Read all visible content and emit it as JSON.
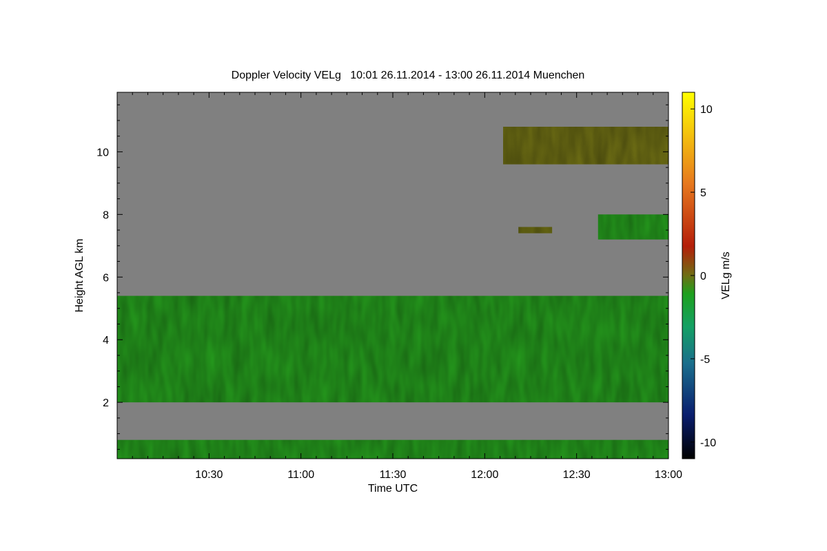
{
  "chart_data": {
    "type": "heatmap",
    "title": "Doppler Velocity VELg   10:01 26.11.2014 - 13:00 26.11.2014 Muenchen",
    "xlabel": "Time UTC",
    "ylabel": "Height AGL km",
    "x_range": [
      "10:01",
      "13:00"
    ],
    "x_ticks": [
      "10:30",
      "11:00",
      "11:30",
      "12:00",
      "12:30",
      "13:00"
    ],
    "x_tick_minutes": [
      30,
      60,
      90,
      120,
      150,
      180
    ],
    "y_range": [
      0.2,
      11.9
    ],
    "y_ticks": [
      2,
      4,
      6,
      8,
      10
    ],
    "colorbar": {
      "label": "VELg m/s",
      "range": [
        -11,
        11
      ],
      "ticks": [
        -10,
        -5,
        0,
        5,
        10
      ],
      "colors": [
        "#000000",
        "#0a1e6e",
        "#1a6e8c",
        "#14a064",
        "#1ea01e",
        "#6e6e14",
        "#b41e0a",
        "#e6781e",
        "#ffff00"
      ]
    },
    "background_color": "#808080",
    "regions": [
      {
        "name": "cloud layer",
        "t_start": 0,
        "t_end": 180,
        "h_bottom": 2.0,
        "h_top": 5.4,
        "velocity": -1
      },
      {
        "name": "cloud patch",
        "t_start": 126,
        "t_end": 180,
        "h_bottom": 9.6,
        "h_top": 10.8,
        "velocity": 0
      },
      {
        "name": "cloud patch",
        "t_start": 157,
        "t_end": 180,
        "h_bottom": 7.2,
        "h_top": 8.0,
        "velocity": -1
      },
      {
        "name": "cloud patch",
        "t_start": 131,
        "t_end": 142,
        "h_bottom": 7.4,
        "h_top": 7.6,
        "velocity": 0
      },
      {
        "name": "near-surface layer",
        "t_start": 0,
        "t_end": 180,
        "h_bottom": 0.2,
        "h_top": 0.8,
        "velocity": -1
      }
    ]
  }
}
